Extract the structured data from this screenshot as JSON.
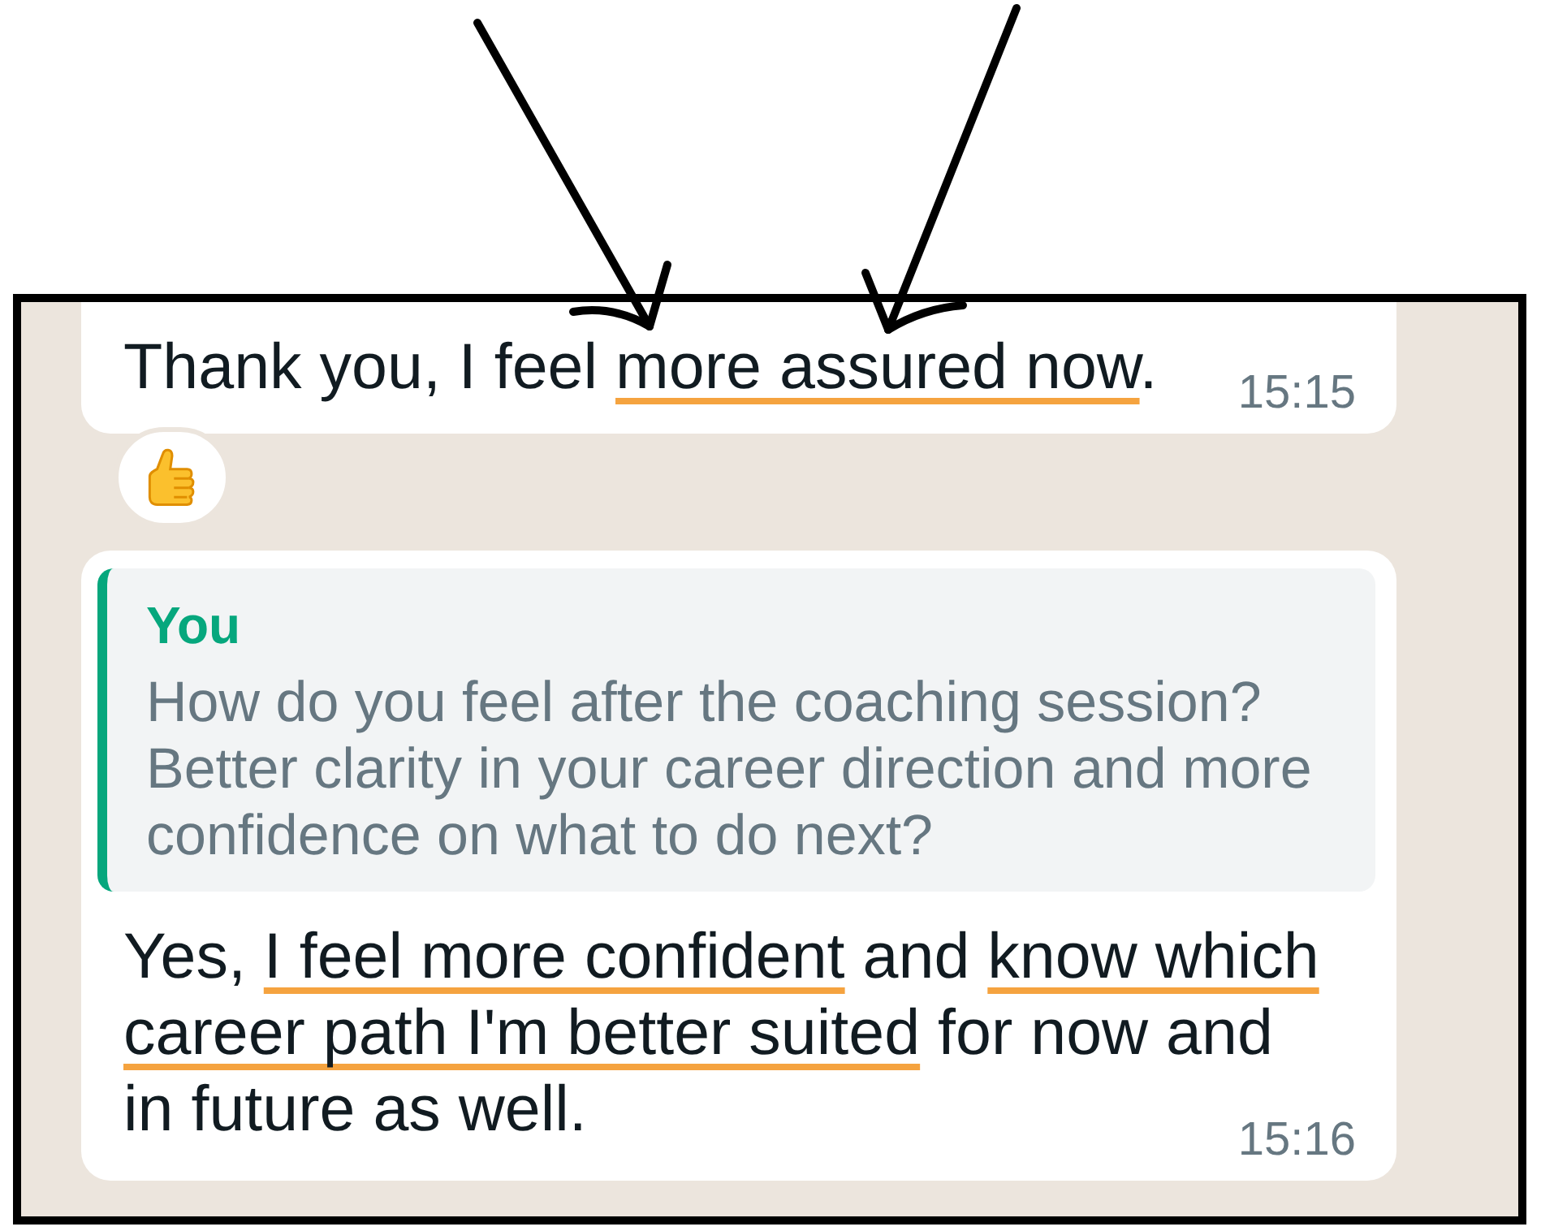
{
  "chat": {
    "messages": [
      {
        "kind": "text",
        "segments": [
          {
            "text": "Thank you, I feel ",
            "underlined": false
          },
          {
            "text": "more assured now",
            "underlined": true
          },
          {
            "text": ".",
            "underlined": false
          }
        ],
        "time": "15:15",
        "reacted": true
      },
      {
        "kind": "reply",
        "quote": {
          "author": "You",
          "text": "How do you feel after the coaching session? Better clarity in your career direction and more confidence on what to do next?"
        },
        "segments": [
          {
            "text": "Yes, ",
            "underlined": false
          },
          {
            "text": "I feel more confident",
            "underlined": true
          },
          {
            "text": " and ",
            "underlined": false
          },
          {
            "text": "know which career path I'm better suited",
            "underlined": true
          },
          {
            "text": " for now and in future as well.",
            "underlined": false
          }
        ],
        "time": "15:16",
        "reacted": false
      }
    ]
  }
}
